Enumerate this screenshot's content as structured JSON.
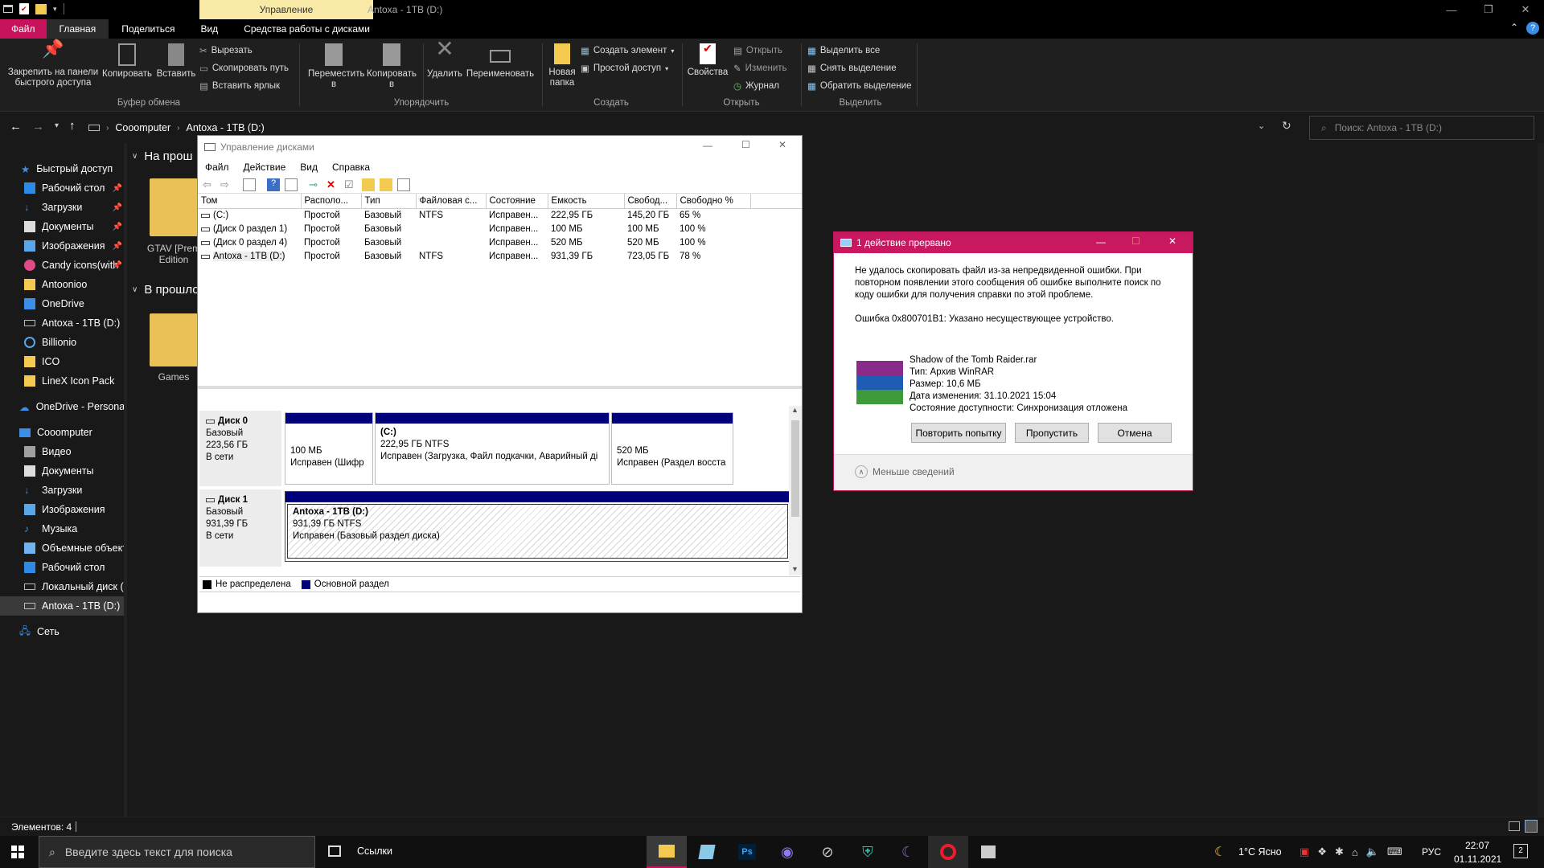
{
  "titlebar": {
    "context_tab": "Управление",
    "title": "Antoxa - 1TB (D:)"
  },
  "ribbon_tabs": [
    {
      "label": "Файл"
    },
    {
      "label": "Главная"
    },
    {
      "label": "Поделиться"
    },
    {
      "label": "Вид"
    },
    {
      "label": "Средства работы с дисками"
    }
  ],
  "ribbon": {
    "pin": "Закрепить на панели быстрого доступа",
    "copy": "Копировать",
    "paste": "Вставить",
    "cut": "Вырезать",
    "copy_path": "Скопировать путь",
    "paste_shortcut": "Вставить ярлык",
    "group_clipboard": "Буфер обмена",
    "move_to": "Переместить в",
    "copy_to": "Копировать в",
    "delete": "Удалить",
    "rename": "Переименовать",
    "group_organize": "Упорядочить",
    "new_folder": "Новая папка",
    "new_item": "Создать элемент",
    "easy_access": "Простой доступ",
    "group_new": "Создать",
    "properties": "Свойства",
    "open": "Открыть",
    "edit": "Изменить",
    "history": "Журнал",
    "group_open": "Открыть",
    "select_all": "Выделить все",
    "select_none": "Снять выделение",
    "invert": "Обратить выделение",
    "group_select": "Выделить"
  },
  "address": {
    "path1": "Cooomputer",
    "path2": "Antoxa - 1TB (D:)",
    "search_placeholder": "Поиск: Antoxa - 1TB (D:)"
  },
  "nav": {
    "quick_access": "Быстрый доступ",
    "quick_items": [
      {
        "label": "Рабочий стол"
      },
      {
        "label": "Загрузки"
      },
      {
        "label": "Документы"
      },
      {
        "label": "Изображения"
      },
      {
        "label": "Candy icons(with"
      },
      {
        "label": "Antoonioo"
      },
      {
        "label": "OneDrive"
      },
      {
        "label": "Antoxa - 1TB (D:)"
      },
      {
        "label": "Billionio"
      },
      {
        "label": "ICO"
      },
      {
        "label": "LineX Icon Pack"
      }
    ],
    "onedrive": "OneDrive - Personal",
    "computer": "Cooomputer",
    "computer_items": [
      {
        "label": "Видео"
      },
      {
        "label": "Документы"
      },
      {
        "label": "Загрузки"
      },
      {
        "label": "Изображения"
      },
      {
        "label": "Музыка"
      },
      {
        "label": "Объемные объект"
      },
      {
        "label": "Рабочий стол"
      },
      {
        "label": "Локальный диск (C"
      },
      {
        "label": "Antoxa - 1TB (D:)"
      }
    ],
    "network": "Сеть"
  },
  "content": {
    "group1": "На прош",
    "file1": "GTAV [Prem Edition",
    "group2": "В прошло",
    "file2": "Games"
  },
  "status": {
    "items": "Элементов: 4"
  },
  "diskmgmt": {
    "title": "Управление дисками",
    "menu": [
      "Файл",
      "Действие",
      "Вид",
      "Справка"
    ],
    "columns": [
      "Том",
      "Располо...",
      "Тип",
      "Файловая с...",
      "Состояние",
      "Емкость",
      "Свобод...",
      "Свободно %"
    ],
    "rows": [
      [
        "(C:)",
        "Простой",
        "Базовый",
        "NTFS",
        "Исправен...",
        "222,95 ГБ",
        "145,20 ГБ",
        "65 %"
      ],
      [
        "(Диск 0 раздел 1)",
        "Простой",
        "Базовый",
        "",
        "Исправен...",
        "100 МБ",
        "100 МБ",
        "100 %"
      ],
      [
        "(Диск 0 раздел 4)",
        "Простой",
        "Базовый",
        "",
        "Исправен...",
        "520 МБ",
        "520 МБ",
        "100 %"
      ],
      [
        "Antoxa - 1TB (D:)",
        "Простой",
        "Базовый",
        "NTFS",
        "Исправен...",
        "931,39 ГБ",
        "723,05 ГБ",
        "78 %"
      ]
    ],
    "disk0": {
      "name": "Диск 0",
      "type": "Базовый",
      "size": "223,56 ГБ",
      "state": "В сети",
      "p1_size": "100 МБ",
      "p1_state": "Исправен (Шифр",
      "p2_name": "(C:)",
      "p2_size": "222,95 ГБ NTFS",
      "p2_state": "Исправен (Загрузка, Файл подкачки, Аварийный ді",
      "p3_size": "520 МБ",
      "p3_state": "Исправен (Раздел восста"
    },
    "disk1": {
      "name": "Диск 1",
      "type": "Базовый",
      "size": "931,39 ГБ",
      "state": "В сети",
      "p1_name": "Antoxa - 1TB  (D:)",
      "p1_size": "931,39 ГБ NTFS",
      "p1_state": "Исправен (Базовый раздел диска)"
    },
    "legend_unalloc": "Не распределена",
    "legend_primary": "Основной раздел"
  },
  "error": {
    "title": "1 действие прервано",
    "message": "Не удалось скопировать файл из-за непредвиденной ошибки. При повторном появлении этого сообщения об ошибке выполните поиск по коду ошибки для получения справки по этой проблеме.",
    "code": "Ошибка 0x800701B1: Указано несуществующее устройство.",
    "file_name": "Shadow of the Tomb Raider.rar",
    "file_type": "Тип: Архив WinRAR",
    "file_size": "Размер: 10,6 МБ",
    "file_date": "Дата изменения: 31.10.2021 15:04",
    "file_status": "Состояние доступности: Синхронизация отложена",
    "retry": "Повторить попытку",
    "skip": "Пропустить",
    "cancel": "Отмена",
    "less": "Меньше сведений"
  },
  "taskbar": {
    "search_placeholder": "Введите здесь текст для поиска",
    "links": "Ссылки",
    "weather": "1°C  Ясно",
    "lang": "РУС",
    "time": "22:07",
    "date": "01.11.2021",
    "notif_count": "2"
  }
}
